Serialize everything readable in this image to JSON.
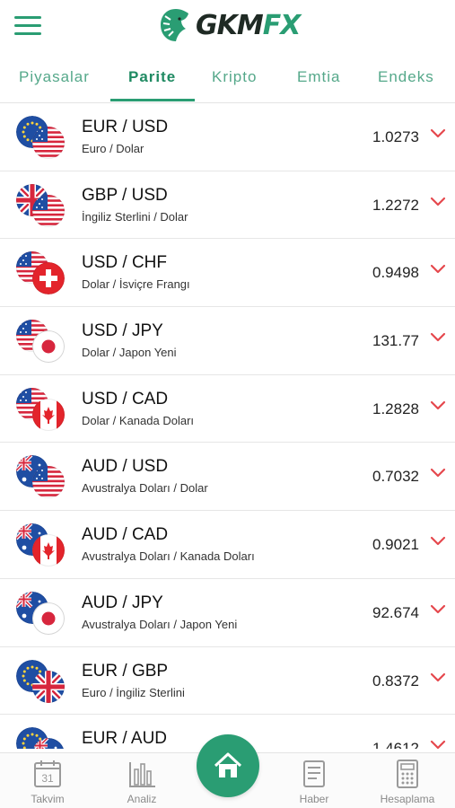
{
  "app": {
    "logo_text_main": "GKM",
    "logo_text_accent": "FX",
    "accent_color": "#2a9d73",
    "down_color": "#e5484d"
  },
  "tabs": [
    {
      "label": "Piyasalar",
      "active": false
    },
    {
      "label": "Parite",
      "active": true
    },
    {
      "label": "Kripto",
      "active": false
    },
    {
      "label": "Emtia",
      "active": false
    },
    {
      "label": "Endeks",
      "active": false
    }
  ],
  "rows": [
    {
      "pair": "EUR / USD",
      "desc": "Euro / Dolar",
      "price": "1.0273",
      "flag_a": "eu",
      "flag_b": "us",
      "trend": "down"
    },
    {
      "pair": "GBP / USD",
      "desc": "İngiliz Sterlini / Dolar",
      "price": "1.2272",
      "flag_a": "gb",
      "flag_b": "us",
      "trend": "down"
    },
    {
      "pair": "USD / CHF",
      "desc": "Dolar / İsviçre Frangı",
      "price": "0.9498",
      "flag_a": "us",
      "flag_b": "ch",
      "trend": "down"
    },
    {
      "pair": "USD / JPY",
      "desc": "Dolar / Japon Yeni",
      "price": "131.77",
      "flag_a": "us",
      "flag_b": "jp",
      "trend": "down"
    },
    {
      "pair": "USD / CAD",
      "desc": "Dolar / Kanada Doları",
      "price": "1.2828",
      "flag_a": "us",
      "flag_b": "ca",
      "trend": "down"
    },
    {
      "pair": "AUD / USD",
      "desc": "Avustralya Doları / Dolar",
      "price": "0.7032",
      "flag_a": "au",
      "flag_b": "us",
      "trend": "down"
    },
    {
      "pair": "AUD / CAD",
      "desc": "Avustralya Doları / Kanada Doları",
      "price": "0.9021",
      "flag_a": "au",
      "flag_b": "ca",
      "trend": "down"
    },
    {
      "pair": "AUD / JPY",
      "desc": "Avustralya Doları / Japon Yeni",
      "price": "92.674",
      "flag_a": "au",
      "flag_b": "jp",
      "trend": "down"
    },
    {
      "pair": "EUR / GBP",
      "desc": "Euro / İngiliz Sterlini",
      "price": "0.8372",
      "flag_a": "eu",
      "flag_b": "gb",
      "trend": "down"
    },
    {
      "pair": "EUR / AUD",
      "desc": "",
      "price": "1.4612",
      "flag_a": "eu",
      "flag_b": "au",
      "trend": "down"
    }
  ],
  "bottom_nav": {
    "calendar_day": "31",
    "items": [
      {
        "label": "Takvim",
        "icon": "calendar-icon"
      },
      {
        "label": "Analiz",
        "icon": "bar-chart-icon"
      },
      {
        "label": "Haber",
        "icon": "news-icon"
      },
      {
        "label": "Hesaplama",
        "icon": "calculator-icon"
      }
    ],
    "home_icon": "home-icon"
  }
}
